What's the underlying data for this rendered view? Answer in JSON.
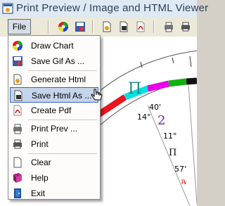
{
  "window": {
    "title": "Print Preview / Image and HTML Viewer"
  },
  "menubar": {
    "file_label": "File"
  },
  "menu": {
    "items": [
      {
        "label": "Draw Chart",
        "icon": "color-wheel-icon"
      },
      {
        "label": "Save Gif As ...",
        "icon": "save-image-icon"
      },
      {
        "label": "Generate Html",
        "icon": "html-document-icon"
      },
      {
        "label": "Save Html As ...",
        "icon": "save-html-icon"
      },
      {
        "label": "Create Pdf",
        "icon": "pdf-icon"
      },
      {
        "label": "Print Prev ...",
        "icon": "print-preview-icon"
      },
      {
        "label": "Print",
        "icon": "printer-icon"
      },
      {
        "label": "Clear",
        "icon": "blank-page-icon"
      },
      {
        "label": "Help",
        "icon": "help-book-icon"
      },
      {
        "label": "Exit",
        "icon": "exit-icon"
      }
    ],
    "highlighted_index": 3
  },
  "chart_labels": {
    "sign_big": "Π",
    "degree_1": "14°",
    "minute_1": "40'",
    "planet_number": "2",
    "degree_2": "11°",
    "sign_small": "Π",
    "minute_2": "57'",
    "retro": "℞"
  },
  "colors": {
    "highlight_bg": "#c4d4ea",
    "highlight_border": "#3968b0",
    "band_red": "#e8141e",
    "band_cyan": "#00e0e0",
    "band_magenta": "#e800e8",
    "band_green": "#10b010",
    "sign_teal": "#1a8a8a",
    "planet_purple": "#6a2a8a",
    "retro_red": "#d01010"
  }
}
